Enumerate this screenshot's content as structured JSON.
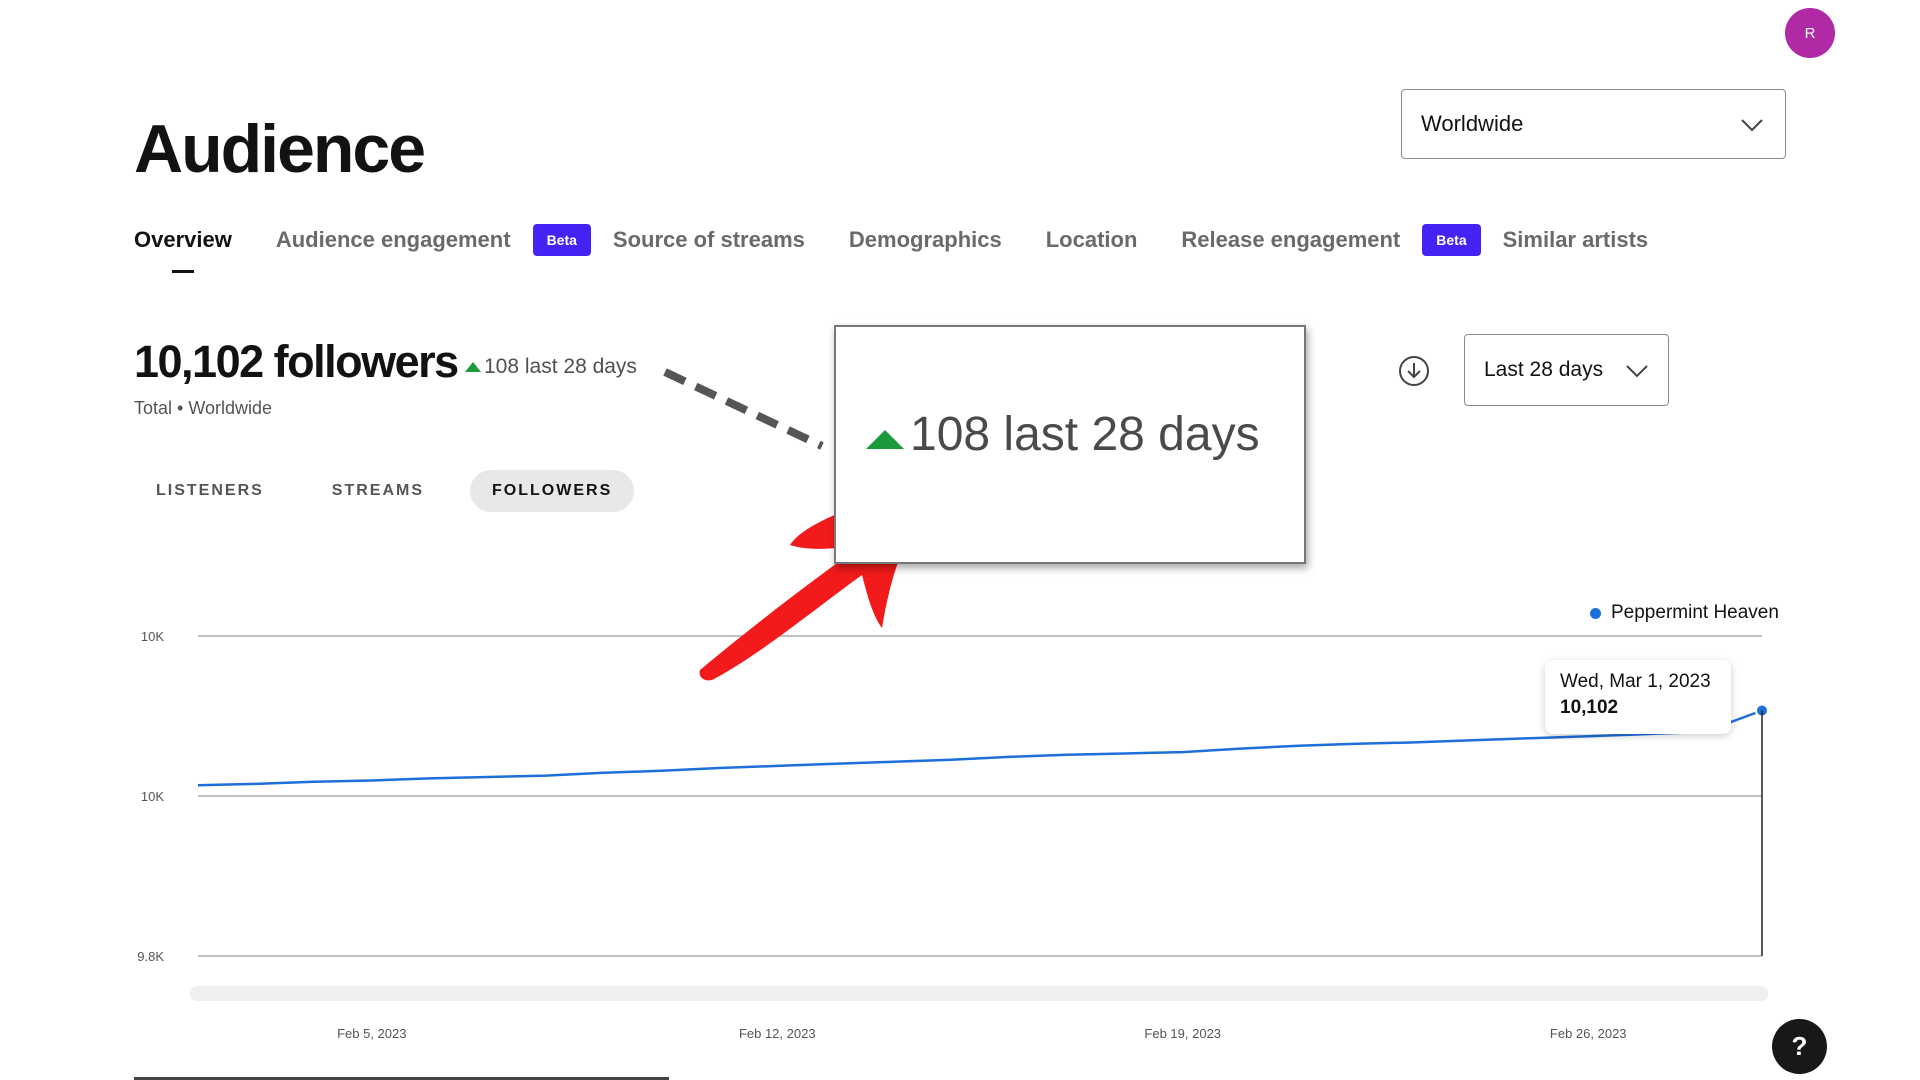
{
  "header": {
    "avatar_initial": "R",
    "title": "Audience"
  },
  "region_select": {
    "value": "Worldwide",
    "icon": "chevron-down-icon"
  },
  "tabs": [
    {
      "label": "Overview",
      "active": true,
      "badge": ""
    },
    {
      "label": "Audience engagement",
      "active": false,
      "badge": "Beta"
    },
    {
      "label": "Source of streams",
      "active": false,
      "badge": ""
    },
    {
      "label": "Demographics",
      "active": false,
      "badge": ""
    },
    {
      "label": "Location",
      "active": false,
      "badge": ""
    },
    {
      "label": "Release engagement",
      "active": false,
      "badge": "Beta"
    },
    {
      "label": "Similar artists",
      "active": false,
      "badge": ""
    }
  ],
  "stats": {
    "headline": "10,102 followers",
    "delta": "108 last 28 days",
    "subtitle": "Total • Worldwide"
  },
  "metric_toggle": [
    {
      "label": "LISTENERS",
      "active": false
    },
    {
      "label": "STREAMS",
      "active": false
    },
    {
      "label": "FOLLOWERS",
      "active": true
    }
  ],
  "annotation": {
    "zoom_text": "108 last 28 days",
    "arrow_color": "#f21a1a",
    "dash_color": "#555555"
  },
  "range_select": {
    "value": "Last 28 days"
  },
  "colors": {
    "accent_green": "#1a9a3b",
    "line_blue": "#1e6fd9",
    "beta_purple": "#4722f5",
    "avatar": "#b02aa6"
  },
  "tooltip": {
    "date": "Wed, Mar 1, 2023",
    "value": "10,102"
  },
  "help_button": {
    "label": "?"
  },
  "chart_data": {
    "type": "line",
    "y_tick_labels": [
      "10K",
      "10K",
      "9.8K"
    ],
    "x_tick_labels": [
      "Feb 5, 2023",
      "Feb 12, 2023",
      "Feb 19, 2023",
      "Feb 26, 2023"
    ],
    "ylim": [
      9800,
      10200
    ],
    "legend": "top-right",
    "series": [
      {
        "name": "Peppermint Heaven",
        "x": [
          "Feb 2",
          "Feb 3",
          "Feb 4",
          "Feb 5",
          "Feb 6",
          "Feb 7",
          "Feb 8",
          "Feb 9",
          "Feb 10",
          "Feb 11",
          "Feb 12",
          "Feb 13",
          "Feb 14",
          "Feb 15",
          "Feb 16",
          "Feb 17",
          "Feb 18",
          "Feb 19",
          "Feb 20",
          "Feb 21",
          "Feb 22",
          "Feb 23",
          "Feb 24",
          "Feb 25",
          "Feb 26",
          "Feb 27",
          "Feb 28",
          "Mar 1"
        ],
        "values": [
          9994,
          9996,
          9999,
          10001,
          10004,
          10006,
          10008,
          10012,
          10015,
          10019,
          10022,
          10025,
          10028,
          10031,
          10035,
          10038,
          10040,
          10042,
          10047,
          10051,
          10054,
          10056,
          10059,
          10062,
          10065,
          10068,
          10071,
          10102
        ]
      }
    ],
    "tooltip_point": {
      "x": "Mar 1",
      "value": 10102
    }
  }
}
